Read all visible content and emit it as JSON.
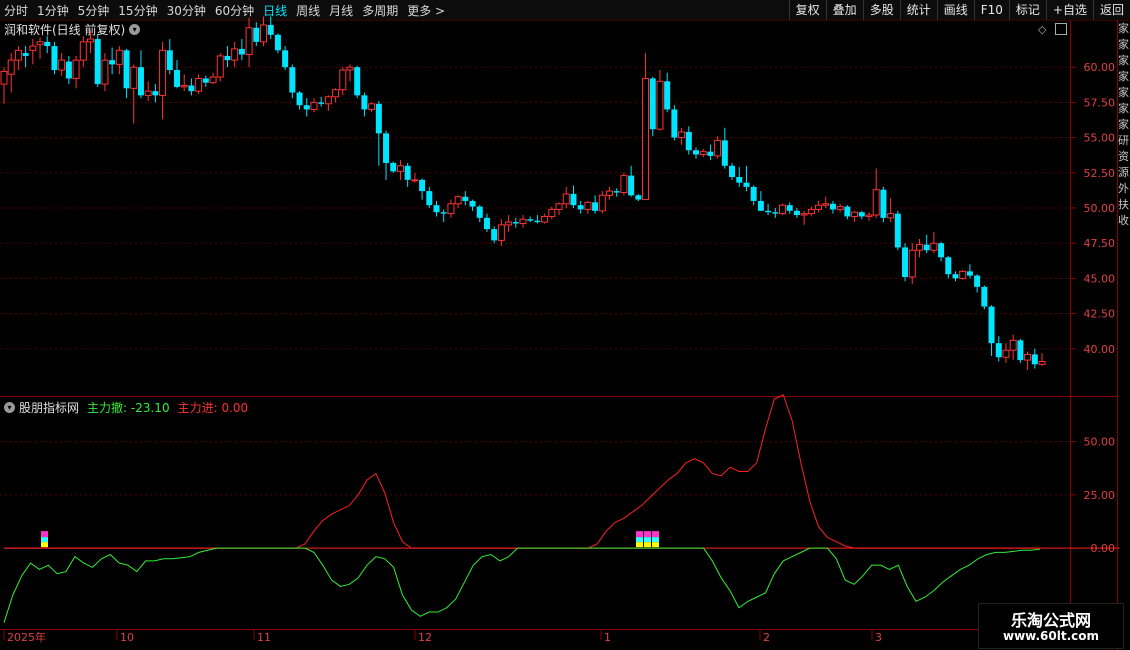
{
  "toolbar": {
    "periods": [
      "分时",
      "1分钟",
      "5分钟",
      "15分钟",
      "30分钟",
      "60分钟",
      "日线",
      "周线",
      "月线",
      "多周期",
      "更多 >"
    ],
    "active_period": "日线",
    "tools": [
      "复权",
      "叠加",
      "多股",
      "统计",
      "画线",
      "F10",
      "标记",
      "+自选",
      "返回"
    ]
  },
  "main_panel": {
    "title": "润和软件(日线 前复权)",
    "price_ticks": [
      "60.00",
      "57.50",
      "55.00",
      "52.50",
      "50.00",
      "47.50",
      "45.00",
      "42.50",
      "40.00"
    ]
  },
  "indicator_panel": {
    "name": "股朋指标网",
    "series1_label": "主力撤:",
    "series1_value": "-23.10",
    "series2_label": "主力进:",
    "series2_value": "0.00",
    "ticks": [
      "50.00",
      "25.00",
      "0.00"
    ]
  },
  "time_axis": [
    "2025年",
    "10",
    "11",
    "12",
    "1",
    "2",
    "3"
  ],
  "watermark": {
    "line1": "乐淘公式网",
    "line2": "www.60lt.com"
  },
  "right_strip_text": "家家家家家家家研资源外扶收",
  "colors": {
    "up": "#ff3232",
    "down": "#00e5ff",
    "green_line": "#33ee33",
    "red_line": "#ff2020",
    "grid": "#5a0000"
  },
  "chart_data": [
    {
      "type": "candlestick",
      "title": "润和软件(日线 前复权)",
      "ylim": [
        37.5,
        62.5
      ],
      "x_labels": [
        "2025年",
        "10",
        "11",
        "12",
        "1",
        "2",
        "3"
      ],
      "ohlc": [
        [
          58.8,
          60.0,
          57.4,
          59.7
        ],
        [
          59.5,
          61.0,
          58.2,
          60.5
        ],
        [
          60.5,
          61.5,
          59.8,
          61.2
        ],
        [
          61.0,
          61.5,
          60.0,
          60.8
        ],
        [
          61.2,
          62.0,
          60.2,
          61.5
        ],
        [
          61.6,
          62.1,
          60.6,
          61.8
        ],
        [
          61.8,
          62.2,
          61.0,
          61.5
        ],
        [
          61.5,
          61.8,
          59.5,
          59.8
        ],
        [
          59.8,
          61.0,
          59.4,
          60.5
        ],
        [
          60.4,
          60.8,
          58.8,
          59.2
        ],
        [
          59.2,
          60.8,
          58.5,
          60.5
        ],
        [
          60.5,
          62.2,
          60.0,
          61.8
        ],
        [
          61.8,
          62.6,
          61.0,
          62.0
        ],
        [
          62.0,
          62.3,
          58.6,
          58.8
        ],
        [
          58.8,
          61.0,
          58.3,
          60.5
        ],
        [
          60.5,
          61.4,
          59.5,
          60.2
        ],
        [
          60.2,
          61.5,
          59.5,
          61.2
        ],
        [
          61.2,
          61.3,
          57.8,
          58.5
        ],
        [
          58.5,
          60.2,
          56.0,
          60.0
        ],
        [
          60.0,
          61.2,
          57.8,
          58.0
        ],
        [
          58.0,
          59.0,
          57.6,
          58.3
        ],
        [
          58.3,
          58.8,
          57.5,
          58.0
        ],
        [
          58.0,
          61.8,
          56.3,
          61.2
        ],
        [
          61.2,
          62.0,
          59.5,
          59.8
        ],
        [
          59.8,
          60.5,
          58.5,
          58.6
        ],
        [
          58.6,
          59.5,
          58.3,
          58.7
        ],
        [
          58.7,
          59.2,
          58.0,
          58.3
        ],
        [
          58.3,
          59.5,
          58.1,
          59.2
        ],
        [
          59.2,
          59.4,
          58.6,
          58.9
        ],
        [
          58.9,
          59.6,
          58.8,
          59.3
        ],
        [
          59.3,
          61.0,
          59.0,
          60.8
        ],
        [
          60.8,
          61.5,
          60.0,
          60.5
        ],
        [
          60.5,
          61.8,
          60.0,
          61.3
        ],
        [
          61.3,
          62.0,
          60.5,
          60.9
        ],
        [
          60.9,
          63.5,
          60.0,
          62.8
        ],
        [
          62.8,
          63.2,
          61.5,
          61.8
        ],
        [
          61.8,
          63.6,
          61.5,
          63.0
        ],
        [
          63.0,
          63.6,
          62.0,
          62.3
        ],
        [
          62.3,
          62.4,
          61.0,
          61.2
        ],
        [
          61.2,
          61.5,
          59.8,
          60.0
        ],
        [
          60.0,
          60.2,
          57.8,
          58.2
        ],
        [
          58.2,
          58.3,
          57.0,
          57.3
        ],
        [
          57.3,
          57.8,
          56.5,
          57.0
        ],
        [
          57.0,
          57.8,
          56.8,
          57.5
        ],
        [
          57.5,
          57.9,
          57.2,
          57.4
        ],
        [
          57.4,
          58.0,
          56.9,
          57.9
        ],
        [
          57.9,
          58.5,
          57.5,
          58.4
        ],
        [
          58.4,
          60.0,
          58.0,
          59.8
        ],
        [
          59.8,
          60.2,
          59.0,
          60.0
        ],
        [
          60.0,
          60.1,
          57.8,
          58.0
        ],
        [
          58.0,
          58.2,
          56.5,
          57.0
        ],
        [
          57.0,
          57.5,
          56.8,
          57.4
        ],
        [
          57.4,
          57.6,
          53.0,
          55.3
        ],
        [
          55.3,
          55.5,
          52.0,
          53.2
        ],
        [
          53.2,
          53.3,
          52.5,
          52.6
        ],
        [
          52.6,
          53.4,
          52.0,
          53.0
        ],
        [
          53.0,
          53.2,
          51.5,
          52.0
        ],
        [
          52.0,
          52.5,
          51.8,
          52.0
        ],
        [
          52.0,
          52.1,
          50.6,
          51.2
        ],
        [
          51.2,
          51.5,
          50.0,
          50.2
        ],
        [
          50.2,
          50.5,
          49.4,
          49.7
        ],
        [
          49.7,
          49.9,
          49.0,
          49.6
        ],
        [
          49.6,
          50.6,
          49.3,
          50.3
        ],
        [
          50.3,
          50.9,
          50.0,
          50.8
        ],
        [
          50.8,
          51.2,
          50.2,
          50.5
        ],
        [
          50.5,
          50.6,
          49.8,
          50.1
        ],
        [
          50.1,
          50.2,
          49.0,
          49.3
        ],
        [
          49.3,
          49.6,
          48.3,
          48.5
        ],
        [
          48.5,
          48.7,
          47.5,
          47.7
        ],
        [
          47.7,
          49.2,
          47.3,
          48.8
        ],
        [
          48.8,
          49.5,
          48.3,
          49.0
        ],
        [
          49.0,
          49.3,
          48.6,
          48.9
        ],
        [
          48.9,
          49.5,
          48.6,
          49.2
        ],
        [
          49.2,
          49.4,
          49.0,
          49.1
        ],
        [
          49.1,
          49.5,
          48.9,
          49.0
        ],
        [
          49.0,
          49.6,
          48.9,
          49.4
        ],
        [
          49.4,
          50.1,
          49.2,
          49.9
        ],
        [
          49.9,
          50.4,
          49.5,
          50.3
        ],
        [
          50.3,
          51.5,
          50.0,
          51.0
        ],
        [
          51.0,
          51.6,
          50.0,
          50.2
        ],
        [
          50.2,
          50.5,
          49.6,
          49.9
        ],
        [
          49.9,
          50.5,
          49.6,
          50.4
        ],
        [
          50.4,
          50.9,
          49.6,
          49.8
        ],
        [
          49.8,
          51.2,
          49.6,
          50.9
        ],
        [
          50.9,
          51.5,
          50.6,
          51.2
        ],
        [
          51.2,
          51.4,
          50.8,
          51.1
        ],
        [
          51.1,
          52.5,
          50.9,
          52.3
        ],
        [
          52.3,
          53.0,
          50.8,
          50.9
        ],
        [
          50.9,
          51.0,
          50.5,
          50.6
        ],
        [
          50.6,
          61.0,
          50.6,
          59.2
        ],
        [
          59.2,
          59.3,
          55.1,
          55.6
        ],
        [
          55.6,
          59.8,
          55.5,
          59.0
        ],
        [
          59.0,
          59.6,
          56.8,
          57.0
        ],
        [
          57.0,
          57.3,
          54.8,
          55.0
        ],
        [
          55.0,
          55.7,
          54.5,
          55.4
        ],
        [
          55.4,
          55.8,
          53.8,
          54.1
        ],
        [
          54.1,
          54.3,
          53.5,
          53.8
        ],
        [
          53.8,
          54.2,
          53.6,
          54.0
        ],
        [
          54.0,
          54.5,
          53.4,
          53.7
        ],
        [
          53.7,
          55.1,
          53.5,
          54.8
        ],
        [
          54.8,
          55.7,
          52.8,
          53.0
        ],
        [
          53.0,
          53.2,
          52.0,
          52.2
        ],
        [
          52.2,
          52.9,
          51.5,
          51.8
        ],
        [
          51.8,
          53.0,
          51.2,
          51.5
        ],
        [
          51.5,
          51.6,
          50.2,
          50.5
        ],
        [
          50.5,
          51.2,
          49.8,
          49.8
        ],
        [
          49.8,
          50.3,
          49.5,
          49.7
        ],
        [
          49.7,
          50.0,
          49.3,
          49.6
        ],
        [
          49.6,
          50.3,
          49.5,
          50.2
        ],
        [
          50.2,
          50.4,
          49.6,
          49.8
        ],
        [
          49.8,
          50.0,
          49.3,
          49.5
        ],
        [
          49.5,
          49.8,
          48.8,
          49.6
        ],
        [
          49.6,
          50.1,
          49.4,
          49.9
        ],
        [
          49.9,
          50.5,
          49.7,
          50.2
        ],
        [
          50.2,
          50.8,
          50.0,
          50.3
        ],
        [
          50.3,
          50.5,
          49.6,
          49.9
        ],
        [
          49.9,
          50.3,
          49.7,
          50.1
        ],
        [
          50.1,
          50.2,
          49.2,
          49.4
        ],
        [
          49.4,
          49.8,
          49.0,
          49.7
        ],
        [
          49.7,
          49.8,
          49.2,
          49.4
        ],
        [
          49.4,
          49.7,
          49.1,
          49.5
        ],
        [
          49.5,
          52.8,
          49.3,
          51.3
        ],
        [
          51.3,
          51.5,
          49.0,
          49.3
        ],
        [
          49.3,
          50.7,
          49.0,
          49.6
        ],
        [
          49.6,
          49.8,
          47.0,
          47.2
        ],
        [
          47.2,
          47.5,
          44.8,
          45.1
        ],
        [
          45.1,
          47.5,
          44.6,
          47.0
        ],
        [
          47.0,
          47.8,
          46.5,
          47.4
        ],
        [
          47.4,
          48.1,
          46.8,
          47.0
        ],
        [
          47.0,
          48.3,
          46.8,
          47.5
        ],
        [
          47.5,
          47.6,
          46.2,
          46.5
        ],
        [
          46.5,
          46.6,
          45.0,
          45.3
        ],
        [
          45.3,
          45.5,
          44.8,
          45.0
        ],
        [
          45.0,
          45.6,
          44.9,
          45.5
        ],
        [
          45.5,
          46.0,
          45.0,
          45.2
        ],
        [
          45.2,
          45.3,
          44.0,
          44.4
        ],
        [
          44.4,
          44.5,
          42.8,
          43.0
        ],
        [
          43.0,
          43.1,
          39.5,
          40.4
        ],
        [
          40.4,
          40.9,
          39.1,
          39.4
        ],
        [
          39.4,
          40.4,
          39.0,
          39.9
        ],
        [
          39.9,
          41.0,
          39.2,
          40.6
        ],
        [
          40.6,
          40.7,
          39.0,
          39.2
        ],
        [
          39.2,
          39.8,
          38.5,
          39.6
        ],
        [
          39.6,
          40.0,
          38.6,
          38.9
        ],
        [
          38.9,
          39.7,
          38.8,
          39.1
        ]
      ]
    },
    {
      "type": "line",
      "title": "股朋指标网",
      "ylim": [
        -37.5,
        62.5
      ],
      "series": [
        {
          "name": "主力撤",
          "values": [
            -35.0,
            -22.0,
            -13.0,
            -7.0,
            -10.0,
            -8.0,
            -12.0,
            -11.0,
            -4.0,
            -7.0,
            -9.0,
            -5.0,
            -3.0,
            -7.0,
            -8.0,
            -11.0,
            -6.0,
            -6.0,
            -5.0,
            -5.0,
            -4.5,
            -4.0,
            -2.0,
            -1.0,
            0.0,
            0.0,
            0.0,
            0.0,
            0.0,
            0.0,
            0.0,
            0.0,
            0.0,
            0.0,
            0.0,
            -2.0,
            -8.0,
            -15.0,
            -18.0,
            -17.0,
            -14.0,
            -8.0,
            -4.0,
            -5.0,
            -9.0,
            -22.0,
            -29.0,
            -32.0,
            -30.0,
            -30.0,
            -28.0,
            -24.0,
            -16.0,
            -8.0,
            -4.0,
            -3.0,
            -6.0,
            -4.0,
            0.0,
            0.0,
            0.0,
            0.0,
            0.0,
            0.0,
            0.0,
            0.0,
            0.0,
            0.0,
            0.0,
            0.0,
            0.0,
            0.0,
            0.0,
            0.0,
            0.0,
            0.0,
            0.0,
            0.0,
            0.0,
            0.0,
            -6.0,
            -14.0,
            -20.0,
            -28.0,
            -25.0,
            -23.0,
            -21.0,
            -12.0,
            -6.0,
            -4.0,
            -2.0,
            0.0,
            0.0,
            0.0,
            -5.0,
            -15.0,
            -17.0,
            -13.0,
            -8.0,
            -8.0,
            -10.0,
            -8.0,
            -18.0,
            -25.0,
            -23.0,
            -20.0,
            -16.0,
            -13.0,
            -10.0,
            -8.0,
            -5.0,
            -3.0,
            -2.0,
            -2.0,
            -1.5,
            -1.0,
            -1.0,
            -0.5
          ]
        },
        {
          "name": "主力进",
          "values": [
            0,
            0,
            0,
            0,
            0,
            0,
            0,
            0,
            0,
            0,
            0,
            0,
            0,
            0,
            0,
            0,
            0,
            0,
            0,
            0,
            0,
            0,
            0,
            0,
            0,
            0,
            0,
            0,
            0,
            0,
            0,
            0,
            0,
            0,
            2.0,
            8.0,
            13.0,
            16.0,
            18.0,
            20.0,
            25.0,
            32.0,
            35.0,
            26.0,
            12.0,
            3.0,
            0.0,
            0,
            0,
            0,
            0,
            0,
            0,
            0,
            0,
            0,
            0,
            0,
            0,
            0,
            0,
            0,
            0,
            0,
            0,
            0,
            0,
            2.0,
            8.0,
            12.0,
            14.0,
            17.0,
            20.0,
            24.0,
            28.0,
            32.0,
            35.0,
            40.0,
            42.0,
            40.0,
            35.0,
            34.0,
            38.0,
            36.0,
            36.0,
            40.0,
            56.0,
            70.0,
            72.0,
            60.0,
            40.0,
            22.0,
            10.0,
            5.0,
            3.0,
            1.0,
            0.0,
            0,
            0,
            0,
            0,
            0,
            0,
            0,
            0,
            0,
            0,
            0,
            0,
            0,
            0,
            0,
            0,
            0,
            0,
            0,
            0,
            0,
            0,
            0,
            0,
            0,
            0,
            0,
            0,
            0,
            0
          ]
        }
      ]
    }
  ]
}
